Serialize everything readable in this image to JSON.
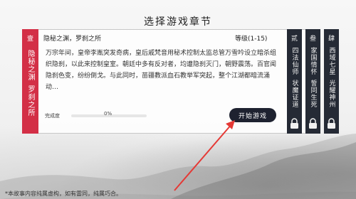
{
  "page": {
    "title": "选择游戏章节",
    "footnote": "*本故事内容纯属虚构，如有雷同，纯属巧合。"
  },
  "current_chapter": {
    "number": "壹",
    "vertical_title": "隐秘之渊",
    "vertical_subtitle": "罗刹之所",
    "heading": "隐秘之渊，罗刹之所",
    "level": "等级(1-15)",
    "story": "万宗年间，皇帝李胤突发奇病，皇后戚梵音用秘术控制太监总管万雪吟设立暗杀组织隐刹，以此来控制皇室。朝廷中多有反对者，均遭隐刹灭门，朝野震荡。百官闻隐刹色变，纷纷倒戈。与此同时，苗疆教派血石教举军突起，整个江湖都暗流涌动…",
    "progress_label": "完成度",
    "progress_value": "0%",
    "progress_fraction": 0,
    "start_button": "开始游戏"
  },
  "locked_chapters": [
    {
      "number": "贰",
      "line1": "四法仙师",
      "line2": "状魔证道"
    },
    {
      "number": "叁",
      "line1": "家国情怀",
      "line2": "誓同生死"
    },
    {
      "number": "肆",
      "line1": "西域七星",
      "line2": "光耀神州"
    }
  ],
  "icons": {
    "lock": "lock-icon",
    "arrow": "pointer-arrow-icon"
  },
  "colors": {
    "accent": "#d32f46",
    "dark": "#252a35",
    "button": "#1e2230"
  }
}
